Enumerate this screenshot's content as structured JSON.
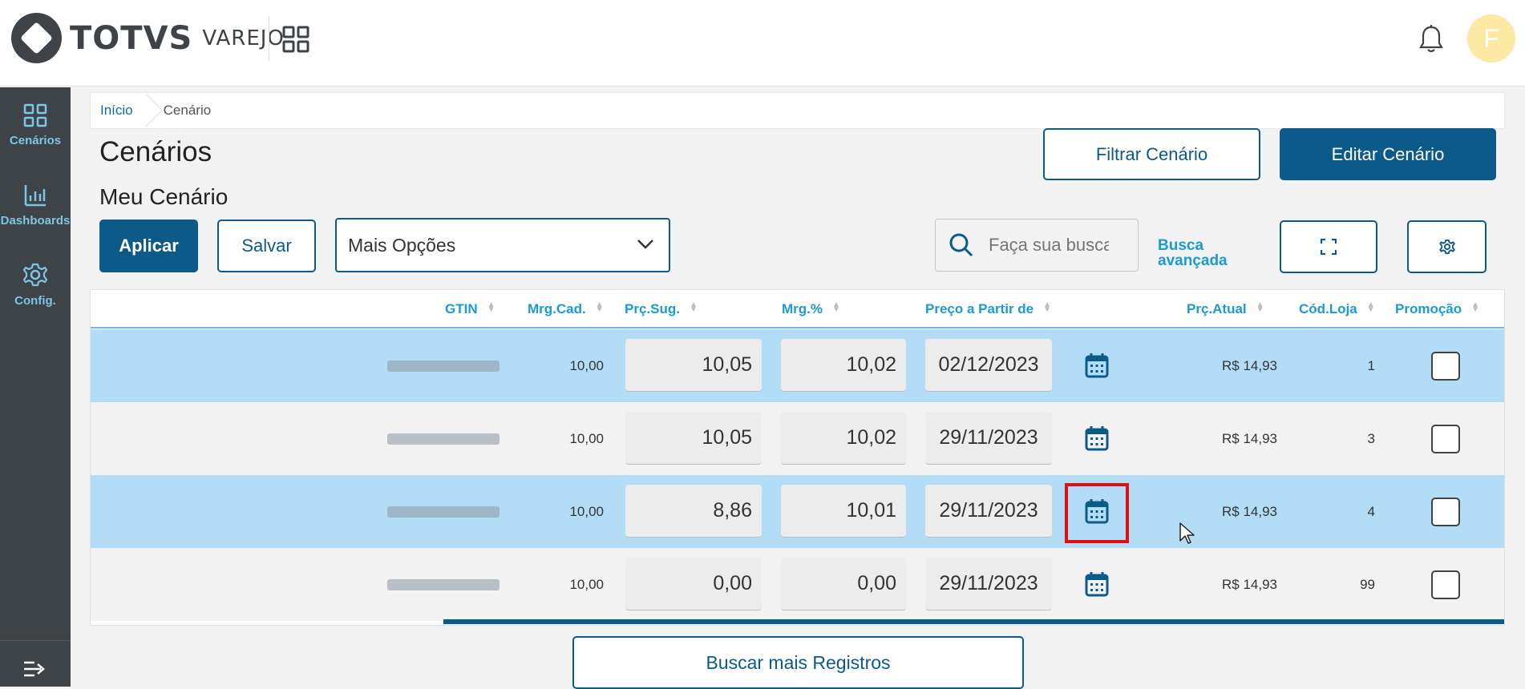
{
  "header": {
    "brand": "TOTVS",
    "brand_sub": "VAREJO",
    "avatar_letter": "F"
  },
  "sidebar": {
    "items": [
      {
        "label": "Cenários",
        "icon": "grid-icon"
      },
      {
        "label": "Dashboards",
        "icon": "bar-chart-icon"
      },
      {
        "label": "Config.",
        "icon": "gear-icon"
      }
    ]
  },
  "breadcrumb": {
    "home": "Início",
    "current": "Cenário"
  },
  "page": {
    "title": "Cenários",
    "subtitle": "Meu Cenário"
  },
  "actions": {
    "filter": "Filtrar Cenário",
    "edit": "Editar Cenário",
    "apply": "Aplicar",
    "save": "Salvar",
    "more_options": "Mais Opções",
    "search_placeholder": "Faça sua busca",
    "advanced_1": "Busca",
    "advanced_2": "avançada",
    "load_more": "Buscar mais Registros"
  },
  "table": {
    "headers": {
      "gtin": "GTIN",
      "mrg_cad": "Mrg.Cad.",
      "prc_sug": "Prç.Sug.",
      "mrg_pct": "Mrg.%",
      "preco_partir": "Preço a Partir de",
      "prc_atual": "Prç.Atual",
      "cod_loja": "Cód.Loja",
      "promocao": "Promoção"
    },
    "rows": [
      {
        "mrg_cad": "10,00",
        "prc_sug": "10,05",
        "mrg_pct": "10,02",
        "date": "02/12/2023",
        "prc_atual": "R$ 14,93",
        "cod_loja": "1"
      },
      {
        "mrg_cad": "10,00",
        "prc_sug": "10,05",
        "mrg_pct": "10,02",
        "date": "29/11/2023",
        "prc_atual": "R$ 14,93",
        "cod_loja": "3"
      },
      {
        "mrg_cad": "10,00",
        "prc_sug": "8,86",
        "mrg_pct": "10,01",
        "date": "29/11/2023",
        "prc_atual": "R$ 14,93",
        "cod_loja": "4"
      },
      {
        "mrg_cad": "10,00",
        "prc_sug": "0,00",
        "mrg_pct": "0,00",
        "date": "29/11/2023",
        "prc_atual": "R$ 14,93",
        "cod_loja": "99"
      }
    ]
  },
  "colors": {
    "primary": "#0c5a8a",
    "accent": "#1a9bd4",
    "row_highlight": "#b3ddf7",
    "sidebar": "#3d4347",
    "focus_box": "#e01010"
  }
}
